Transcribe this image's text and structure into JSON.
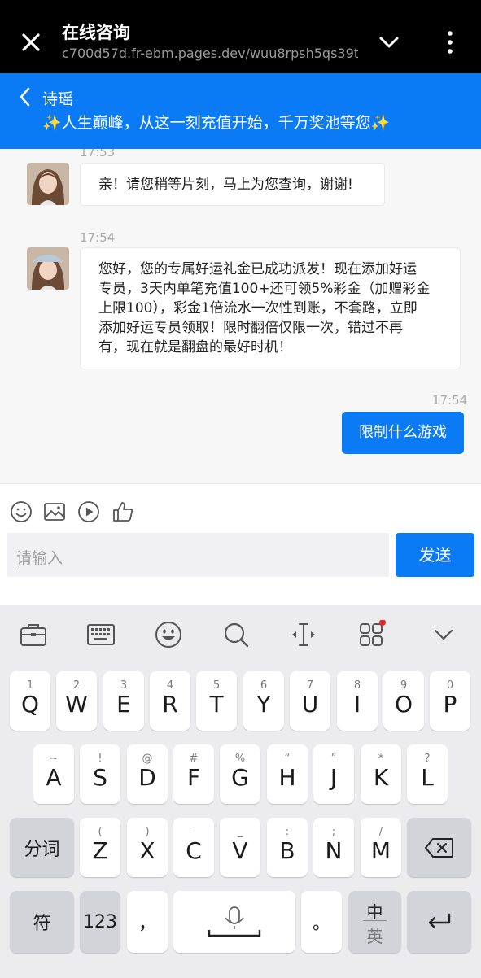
{
  "browser": {
    "title": "在线咨询",
    "url": "c700d57d.fr-ebm.pages.dev/wuu8rpsh5qs39t"
  },
  "chat_header": {
    "agent_name": "诗瑶",
    "slogan": "✨人生巅峰，从这一刻充值开始，千万奖池等您✨"
  },
  "messages": {
    "m1": {
      "time": "17:53",
      "text": "亲！请您稍等片刻，马上为您查询，谢谢!"
    },
    "m2": {
      "time": "17:54",
      "lines": [
        "您好，您的专属好运礼金已成功派发！现在添加好运",
        "专员，3天内单笔充值100+还可领5%彩金（加赠彩金",
        "上限100），彩金1倍流水一次性到账，不套路，立即",
        "添加好运专员领取！限时翻倍仅限一次，错过不再",
        "有，现在就是翻盘的最好时机！"
      ]
    },
    "m3": {
      "time": "17:54",
      "text": "限制什么游戏"
    }
  },
  "composer": {
    "placeholder": "请输入",
    "send_label": "发送",
    "tools": [
      "emoji-icon",
      "image-icon",
      "video-icon",
      "thumbs-up-icon"
    ]
  },
  "keyboard": {
    "toolbar": [
      "briefcase-icon",
      "keyboard-icon",
      "emoji-icon",
      "search-icon",
      "cursor-move-icon",
      "apps-grid-icon",
      "collapse-chevron-icon"
    ],
    "row1": [
      {
        "hint": "1",
        "key": "Q"
      },
      {
        "hint": "2",
        "key": "W"
      },
      {
        "hint": "3",
        "key": "E"
      },
      {
        "hint": "4",
        "key": "R"
      },
      {
        "hint": "5",
        "key": "T"
      },
      {
        "hint": "6",
        "key": "Y"
      },
      {
        "hint": "7",
        "key": "U"
      },
      {
        "hint": "8",
        "key": "I"
      },
      {
        "hint": "9",
        "key": "O"
      },
      {
        "hint": "0",
        "key": "P"
      }
    ],
    "row2": [
      {
        "hint": "~",
        "key": "A"
      },
      {
        "hint": "!",
        "key": "S"
      },
      {
        "hint": "@",
        "key": "D"
      },
      {
        "hint": "#",
        "key": "F"
      },
      {
        "hint": "%",
        "key": "G"
      },
      {
        "hint": "“",
        "key": "H"
      },
      {
        "hint": "”",
        "key": "J"
      },
      {
        "hint": "*",
        "key": "K"
      },
      {
        "hint": "?",
        "key": "L"
      }
    ],
    "row3": [
      {
        "hint": "(",
        "key": "Z"
      },
      {
        "hint": ")",
        "key": "X"
      },
      {
        "hint": "-",
        "key": "C"
      },
      {
        "hint": "_",
        "key": "V"
      },
      {
        "hint": ":",
        "key": "B"
      },
      {
        "hint": ";",
        "key": "N"
      },
      {
        "hint": "/",
        "key": "M"
      }
    ],
    "fenci": "分词",
    "fu": "符",
    "num": "123",
    "comma": "，",
    "period": "。",
    "lang_top": "中",
    "lang_bottom": "英"
  }
}
